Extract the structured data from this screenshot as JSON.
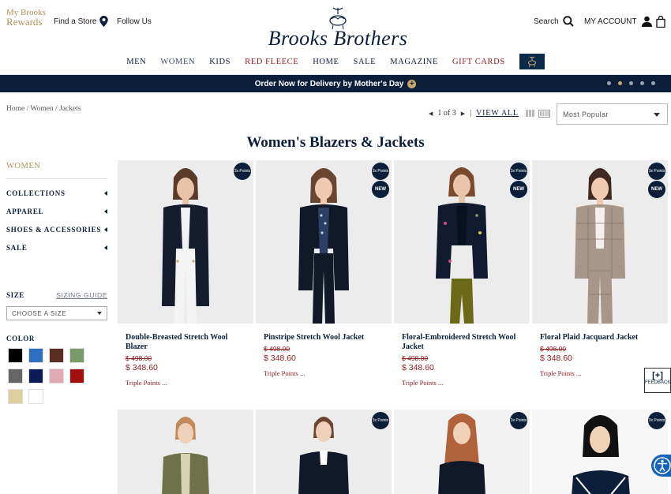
{
  "header": {
    "rewards_line1": "My Brooks",
    "rewards_line2": "Rewards",
    "find_store": "Find a Store",
    "follow_us": "Follow Us",
    "logo": "Brooks Brothers",
    "search": "Search",
    "account": "MY ACCOUNT"
  },
  "nav": [
    "MEN",
    "WOMEN",
    "KIDS",
    "RED FLEECE",
    "HOME",
    "SALE",
    "MAGAZINE",
    "GIFT CARDS"
  ],
  "promo": {
    "text": "Order Now for Delivery by Mother's Day",
    "plus": "+"
  },
  "breadcrumb": "Home / Women / Jackets",
  "pager": {
    "current": "1 of 3",
    "view_all": "VIEW ALL"
  },
  "sort": {
    "selected": "Most Popular"
  },
  "page_title": "Women's Blazers & Jackets",
  "sidebar": {
    "heading": "WOMEN",
    "items": [
      "COLLECTIONS",
      "APPAREL",
      "SHOES & ACCESSORIES",
      "SALE"
    ],
    "size_label": "SIZE",
    "sizing_guide": "SIZING GUIDE",
    "size_placeholder": "CHOOSE A SIZE",
    "color_label": "COLOR",
    "colors": [
      "#000000",
      "#2e6fbf",
      "#5a2e22",
      "#7a9a6a",
      "#666666",
      "#0c1a55",
      "#e0aab5",
      "#a30f0f",
      "#ddcfa0",
      "#ffffff"
    ]
  },
  "badges": {
    "points": "3x Points",
    "new": "NEW"
  },
  "products": [
    {
      "name": "Double-Breasted Stretch Wool Blazer",
      "old_price": "$ 498.00",
      "price": "$ 348.60",
      "points": "Triple Points ...",
      "is_new": false
    },
    {
      "name": "Pinstripe Stretch Wool Jacket",
      "old_price": "$ 498.00",
      "price": "$ 348.60",
      "points": "Triple Points ...",
      "is_new": true
    },
    {
      "name": "Floral-Embroidered Stretch Wool Jacket",
      "old_price": "$ 498.00",
      "price": "$ 348.60",
      "points": "Triple Points ...",
      "is_new": true
    },
    {
      "name": "Floral Plaid Jacquard Jacket",
      "old_price": "$ 498.00",
      "price": "$ 348.60",
      "points": "Triple Points ...",
      "is_new": true
    }
  ],
  "feedback": {
    "plus": "[+]",
    "label": "FEEDBACK"
  }
}
